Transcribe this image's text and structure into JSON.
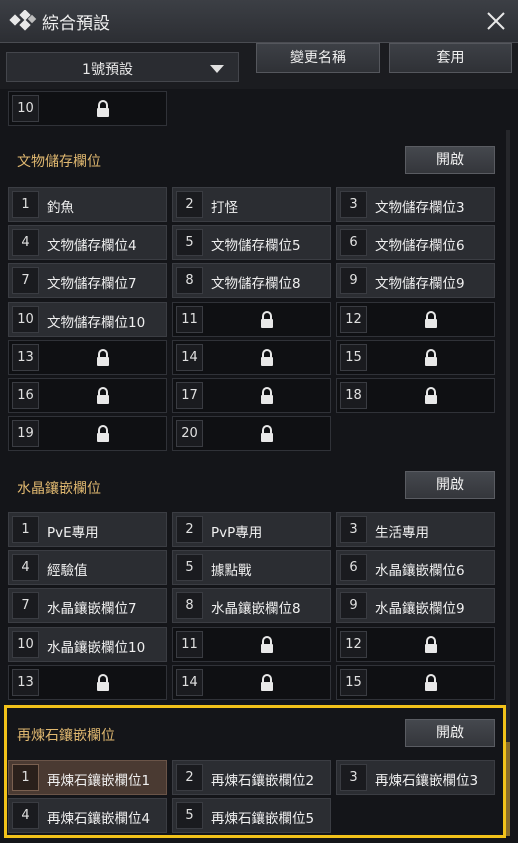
{
  "window": {
    "title": "綜合預設"
  },
  "toolbar": {
    "preset_select": "1號預設",
    "rename_label": "變更名稱",
    "apply_label": "套用"
  },
  "sections": [
    {
      "title": "",
      "open_label": "",
      "slots": [
        {
          "num": "10",
          "label": "",
          "locked": true
        }
      ]
    },
    {
      "title": "文物儲存欄位",
      "open_label": "開啟",
      "slots": [
        {
          "num": "1",
          "label": "釣魚",
          "locked": false
        },
        {
          "num": "2",
          "label": "打怪",
          "locked": false
        },
        {
          "num": "3",
          "label": "文物儲存欄位3",
          "locked": false
        },
        {
          "num": "4",
          "label": "文物儲存欄位4",
          "locked": false
        },
        {
          "num": "5",
          "label": "文物儲存欄位5",
          "locked": false
        },
        {
          "num": "6",
          "label": "文物儲存欄位6",
          "locked": false
        },
        {
          "num": "7",
          "label": "文物儲存欄位7",
          "locked": false
        },
        {
          "num": "8",
          "label": "文物儲存欄位8",
          "locked": false
        },
        {
          "num": "9",
          "label": "文物儲存欄位9",
          "locked": false
        },
        {
          "num": "10",
          "label": "文物儲存欄位10",
          "locked": false
        },
        {
          "num": "11",
          "label": "",
          "locked": true
        },
        {
          "num": "12",
          "label": "",
          "locked": true
        },
        {
          "num": "13",
          "label": "",
          "locked": true
        },
        {
          "num": "14",
          "label": "",
          "locked": true
        },
        {
          "num": "15",
          "label": "",
          "locked": true
        },
        {
          "num": "16",
          "label": "",
          "locked": true
        },
        {
          "num": "17",
          "label": "",
          "locked": true
        },
        {
          "num": "18",
          "label": "",
          "locked": true
        },
        {
          "num": "19",
          "label": "",
          "locked": true
        },
        {
          "num": "20",
          "label": "",
          "locked": true
        }
      ]
    },
    {
      "title": "水晶鑲嵌欄位",
      "open_label": "開啟",
      "slots": [
        {
          "num": "1",
          "label": "PvE專用",
          "locked": false
        },
        {
          "num": "2",
          "label": "PvP專用",
          "locked": false
        },
        {
          "num": "3",
          "label": "生活專用",
          "locked": false
        },
        {
          "num": "4",
          "label": "經驗值",
          "locked": false
        },
        {
          "num": "5",
          "label": "據點戰",
          "locked": false
        },
        {
          "num": "6",
          "label": "水晶鑲嵌欄位6",
          "locked": false
        },
        {
          "num": "7",
          "label": "水晶鑲嵌欄位7",
          "locked": false
        },
        {
          "num": "8",
          "label": "水晶鑲嵌欄位8",
          "locked": false
        },
        {
          "num": "9",
          "label": "水晶鑲嵌欄位9",
          "locked": false
        },
        {
          "num": "10",
          "label": "水晶鑲嵌欄位10",
          "locked": false
        },
        {
          "num": "11",
          "label": "",
          "locked": true
        },
        {
          "num": "12",
          "label": "",
          "locked": true
        },
        {
          "num": "13",
          "label": "",
          "locked": true
        },
        {
          "num": "14",
          "label": "",
          "locked": true
        },
        {
          "num": "15",
          "label": "",
          "locked": true
        }
      ]
    },
    {
      "title": "再煉石鑲嵌欄位",
      "open_label": "開啟",
      "slots": [
        {
          "num": "1",
          "label": "再煉石鑲嵌欄位1",
          "locked": false,
          "selected": true
        },
        {
          "num": "2",
          "label": "再煉石鑲嵌欄位2",
          "locked": false
        },
        {
          "num": "3",
          "label": "再煉石鑲嵌欄位3",
          "locked": false
        },
        {
          "num": "4",
          "label": "再煉石鑲嵌欄位4",
          "locked": false
        },
        {
          "num": "5",
          "label": "再煉石鑲嵌欄位5",
          "locked": false
        }
      ]
    }
  ],
  "icons": {
    "logo": "diamond-logo-icon",
    "close": "close-icon",
    "lock": "lock-icon",
    "caret": "chevron-down-icon"
  },
  "colors": {
    "section_title": "#e0b870",
    "highlight": "#f2c21a",
    "selected_slot": "#4a3a32"
  }
}
